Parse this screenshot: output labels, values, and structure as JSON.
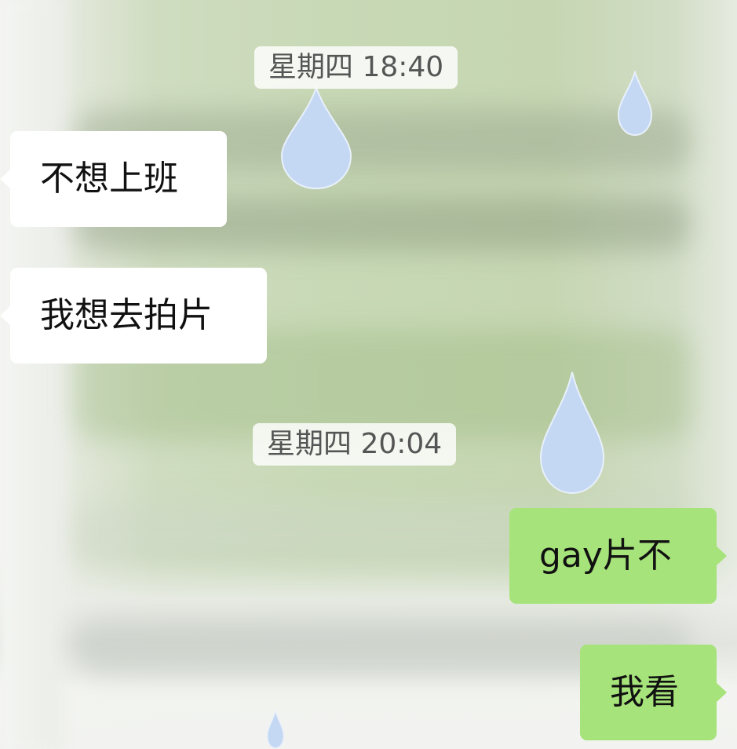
{
  "chat": {
    "colors": {
      "incoming_bubble": "#ffffff",
      "outgoing_bubble": "#a6e37a",
      "timestamp_bg": "rgba(255,255,255,0.82)",
      "raindrop": "#c4d8f3"
    },
    "background": "blurred-window-rain-wallpaper",
    "timestamps": [
      {
        "text": "星期四 18:40"
      },
      {
        "text": "星期四 20:04"
      }
    ],
    "messages": [
      {
        "side": "incoming",
        "text": "不想上班"
      },
      {
        "side": "incoming",
        "text": "我想去拍片"
      },
      {
        "side": "outgoing",
        "text": "gay片不"
      },
      {
        "side": "outgoing",
        "text": "我看"
      }
    ]
  }
}
